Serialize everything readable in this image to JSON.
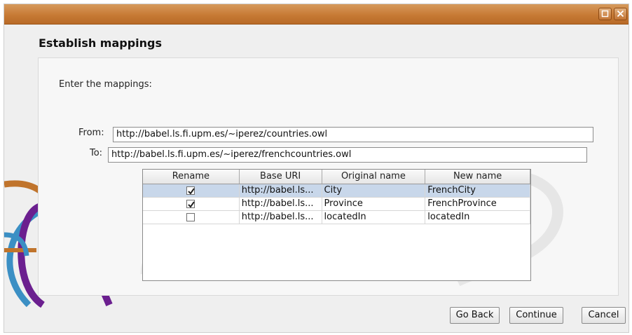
{
  "window": {
    "maximize_icon": "maximize-icon",
    "close_icon": "close-icon"
  },
  "heading": "Establish mappings",
  "prompt": "Enter the mappings:",
  "from": {
    "label": "From:",
    "value": "http://babel.ls.fi.upm.es/~iperez/countries.owl"
  },
  "to": {
    "label": "To:",
    "value": "http://babel.ls.fi.upm.es/~iperez/frenchcountries.owl"
  },
  "table": {
    "headers": [
      "Rename",
      "Base URI",
      "Original name",
      "New name"
    ],
    "rows": [
      {
        "rename": true,
        "base_uri": "http://babel.ls...",
        "original": "City",
        "new_name": "FrenchCity",
        "selected": true
      },
      {
        "rename": true,
        "base_uri": "http://babel.ls...",
        "original": "Province",
        "new_name": "FrenchProvince",
        "selected": false
      },
      {
        "rename": false,
        "base_uri": "http://babel.ls...",
        "original": "locatedIn",
        "new_name": "locatedIn",
        "selected": false
      }
    ]
  },
  "buttons": {
    "go_back": "Go Back",
    "continue": "Continue",
    "cancel": "Cancel"
  },
  "colors": {
    "titlebar": "#c77a35",
    "selection": "#c8d7ea"
  }
}
